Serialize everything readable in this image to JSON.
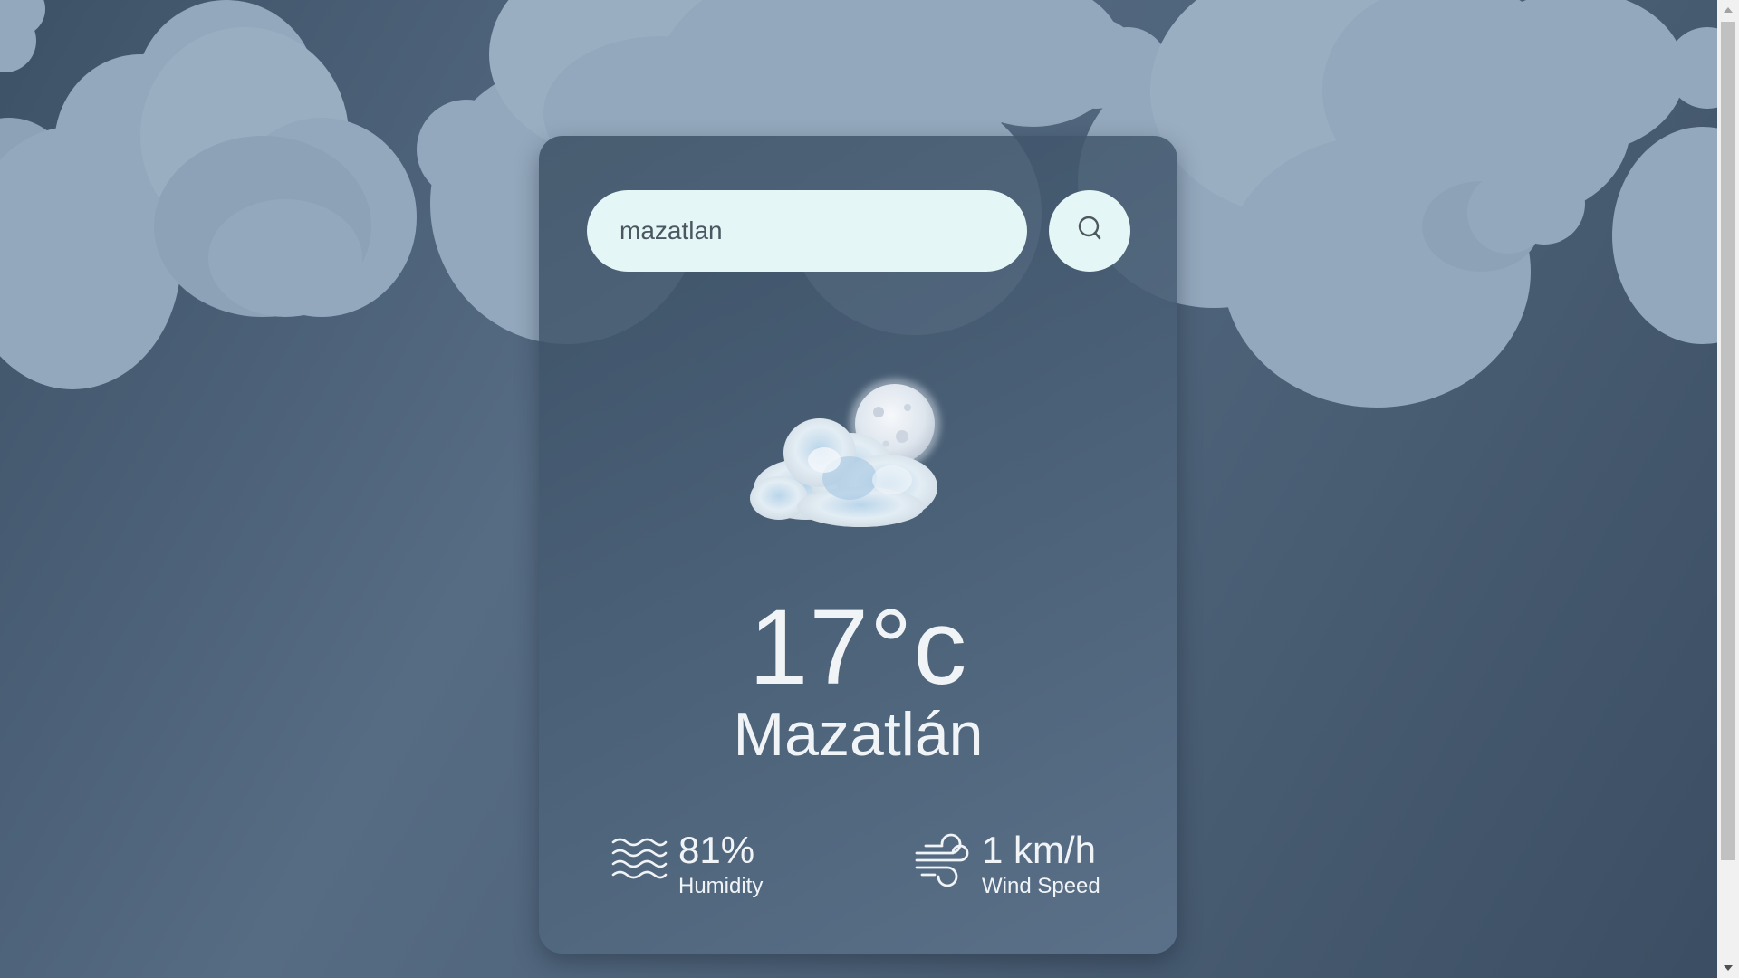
{
  "search": {
    "value": "mazatlan",
    "button_icon": "search-icon"
  },
  "weather": {
    "condition_icon": "cloud-moon-icon",
    "temperature": "17°c",
    "city": "Mazatlán"
  },
  "stats": {
    "humidity": {
      "icon": "humidity-waves-icon",
      "value": "81%",
      "label": "Humidity"
    },
    "wind": {
      "icon": "wind-icon",
      "value": "1 km/h",
      "label": "Wind Speed"
    }
  },
  "colors": {
    "background": "#4d6278",
    "card": "#4a5f75",
    "input": "#e4f6f5",
    "cloud": "#94a8bd",
    "text": "#f1f4f7"
  }
}
